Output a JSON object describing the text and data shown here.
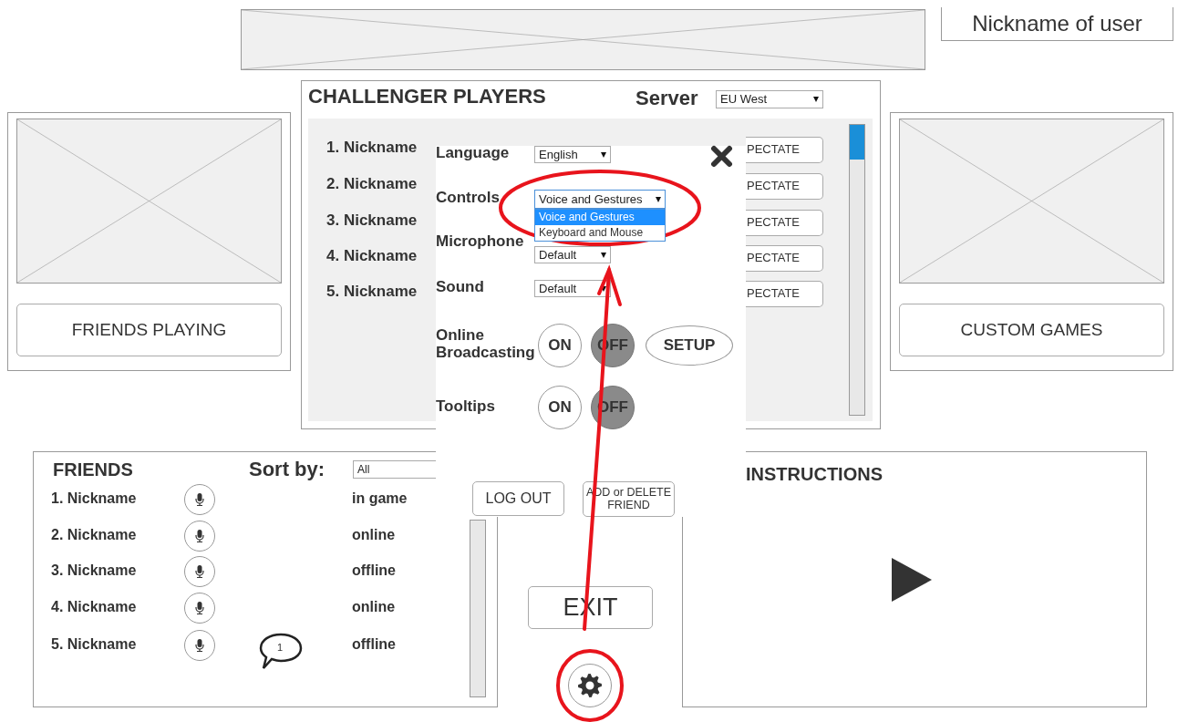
{
  "header": {
    "user_nickname": "Nickname of user"
  },
  "friends_playing": {
    "button": "FRIENDS PLAYING"
  },
  "custom_games": {
    "button": "CUSTOM GAMES"
  },
  "challenger": {
    "title": "CHALLENGER PLAYERS",
    "server_label": "Server",
    "server_value": "EU West",
    "players": [
      {
        "name": "1. Nickname",
        "action": "PECTATE"
      },
      {
        "name": "2. Nickname",
        "action": "PECTATE"
      },
      {
        "name": "3. Nickname",
        "action": "PECTATE"
      },
      {
        "name": "4. Nickname",
        "action": "PECTATE"
      },
      {
        "name": "5. Nickname",
        "action": "PECTATE"
      }
    ]
  },
  "settings": {
    "rows": [
      {
        "kind": "select",
        "label": "Language",
        "value": "English"
      },
      {
        "kind": "select",
        "label": "Controls",
        "value": "Voice and Gestures",
        "expanded": true,
        "options": [
          {
            "label": "Voice and Gestures",
            "selected": true
          },
          {
            "label": "Keyboard and Mouse",
            "selected": false
          }
        ]
      },
      {
        "kind": "select",
        "label": "Microphone",
        "value": "Default"
      },
      {
        "kind": "select",
        "label": "Sound",
        "value": "Default"
      },
      {
        "kind": "toggle",
        "label": "Online Broadcasting",
        "on": false,
        "on_text": "ON",
        "off_text": "OFF",
        "extra_button": "SETUP"
      },
      {
        "kind": "toggle",
        "label": "Tooltips",
        "on": false,
        "on_text": "ON",
        "off_text": "OFF"
      }
    ]
  },
  "friends": {
    "title": "FRIENDS",
    "sort_label": "Sort by:",
    "sort_value": "All",
    "items": [
      {
        "name": "1. Nickname",
        "status": "in game"
      },
      {
        "name": "2. Nickname",
        "status": "online"
      },
      {
        "name": "3. Nickname",
        "status": "offline"
      },
      {
        "name": "4. Nickname",
        "status": "online"
      },
      {
        "name": "5. Nickname",
        "status": "offline",
        "unread": "1"
      }
    ]
  },
  "actions": {
    "log_out": "LOG OUT",
    "add_delete": "ADD or DELETE FRIEND",
    "exit": "EXIT"
  },
  "instructions": {
    "title": "INSTRUCTIONS"
  }
}
